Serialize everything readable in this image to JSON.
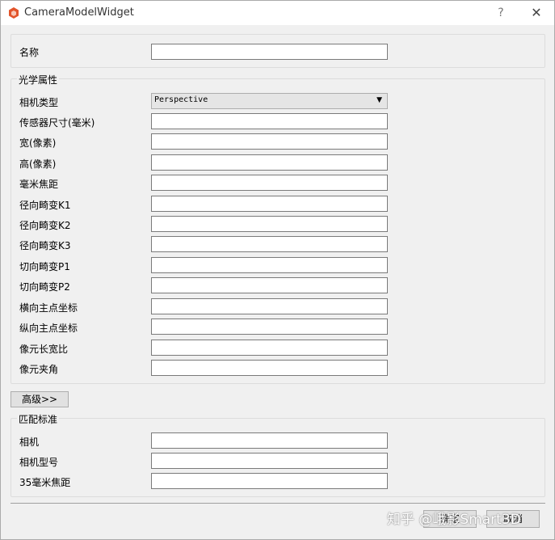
{
  "window": {
    "title": "CameraModelWidget",
    "help_label": "?",
    "close_label": "✕",
    "accent": "#e2542b"
  },
  "name_row": {
    "label": "名称",
    "value": ""
  },
  "optical": {
    "title": "光学属性",
    "camera_type_label": "相机类型",
    "camera_type_value": "Perspective",
    "fields": [
      {
        "label": "传感器尺寸(毫米)",
        "value": ""
      },
      {
        "label": "宽(像素)",
        "value": ""
      },
      {
        "label": "高(像素)",
        "value": ""
      },
      {
        "label": "毫米焦距",
        "value": ""
      },
      {
        "label": "径向畸变K1",
        "value": ""
      },
      {
        "label": "径向畸变K2",
        "value": ""
      },
      {
        "label": "径向畸变K3",
        "value": ""
      },
      {
        "label": "切向畸变P1",
        "value": ""
      },
      {
        "label": "切向畸变P2",
        "value": ""
      },
      {
        "label": "横向主点坐标",
        "value": ""
      },
      {
        "label": "纵向主点坐标",
        "value": ""
      },
      {
        "label": "像元长宽比",
        "value": ""
      },
      {
        "label": "像元夹角",
        "value": ""
      }
    ]
  },
  "advanced_button": "高级>>",
  "match": {
    "title": "匹配标准",
    "fields": [
      {
        "label": "相机",
        "value": ""
      },
      {
        "label": "相机型号",
        "value": ""
      },
      {
        "label": "35毫米焦距",
        "value": ""
      }
    ]
  },
  "footer": {
    "watermark": "知乎 @峨影Smart3D",
    "ok_label": "确定",
    "cancel_label": "取消"
  }
}
